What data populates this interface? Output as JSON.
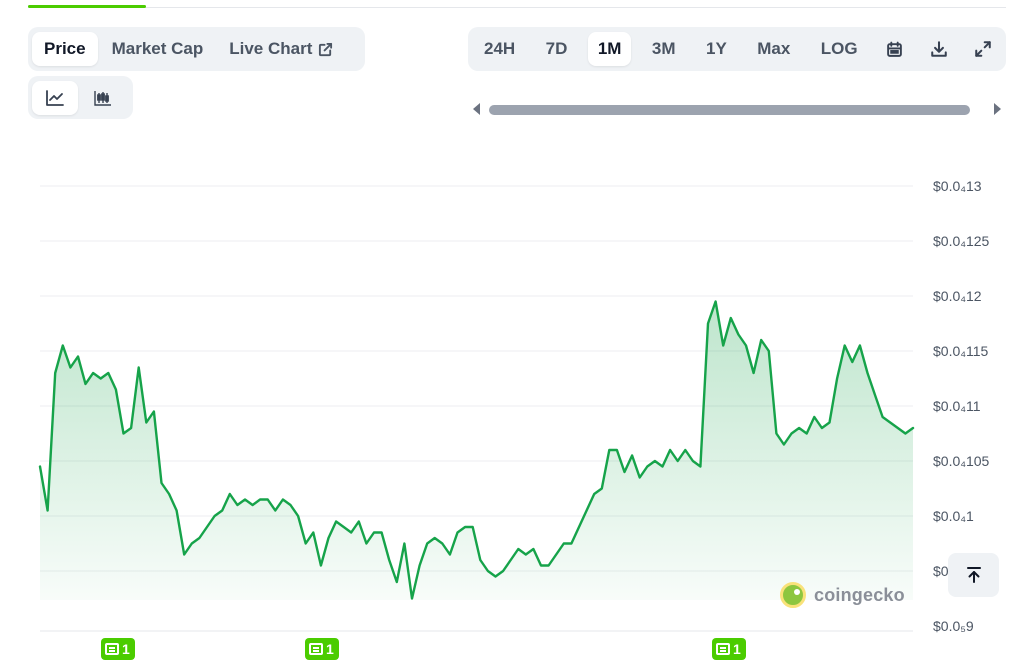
{
  "metric_tabs": [
    {
      "label": "Price",
      "active": true
    },
    {
      "label": "Market Cap",
      "active": false
    },
    {
      "label": "Live Chart",
      "active": false
    }
  ],
  "chart_type_toggle": [
    {
      "icon": "line-chart-icon",
      "active": true
    },
    {
      "icon": "candlestick-chart-icon",
      "active": false
    }
  ],
  "range_tabs": [
    {
      "label": "24H",
      "active": false
    },
    {
      "label": "7D",
      "active": false
    },
    {
      "label": "1M",
      "active": true
    },
    {
      "label": "3M",
      "active": false
    },
    {
      "label": "1Y",
      "active": false
    },
    {
      "label": "Max",
      "active": false
    },
    {
      "label": "LOG",
      "active": false
    }
  ],
  "range_icons": [
    "calendar-icon",
    "download-icon",
    "expand-icon"
  ],
  "watermark": "coingecko",
  "news_markers": [
    {
      "count": "1"
    },
    {
      "count": "1"
    },
    {
      "count": "1"
    }
  ],
  "colors": {
    "accent": "#4bcc00",
    "line": "#16a34a",
    "tab_bg": "#eff2f5"
  },
  "chart_data": {
    "type": "area",
    "title": "",
    "xlabel": "",
    "ylabel": "",
    "ylim": [
      8.95e-05,
      1.31e-05
    ],
    "y_tick_labels": [
      "$0.0₄13",
      "$0.0₄125",
      "$0.0₄12",
      "$0.0₄115",
      "$0.0₄11",
      "$0.0₄105",
      "$0.0₄1",
      "$0.0",
      "$0.0₅9"
    ],
    "y_tick_values": [
      1.3e-05,
      1.25e-05,
      1.2e-05,
      1.15e-05,
      1.1e-05,
      1.05e-05,
      1e-05,
      9.5e-06,
      9e-06
    ],
    "grid": true,
    "legend": "none",
    "series": [
      {
        "values": [
          1.045e-05,
          1.005e-05,
          1.13e-05,
          1.155e-05,
          1.135e-05,
          1.145e-05,
          1.12e-05,
          1.13e-05,
          1.125e-05,
          1.13e-05,
          1.115e-05,
          1.075e-05,
          1.08e-05,
          1.135e-05,
          1.085e-05,
          1.095e-05,
          1.03e-05,
          1.02e-05,
          1.005e-05,
          9.65e-06,
          9.75e-06,
          9.8e-06,
          9.9e-06,
          1e-05,
          1.005e-05,
          1.02e-05,
          1.01e-05,
          1.015e-05,
          1.01e-05,
          1.015e-05,
          1.015e-05,
          1.005e-05,
          1.015e-05,
          1.01e-05,
          1e-05,
          9.75e-06,
          9.85e-06,
          9.55e-06,
          9.8e-06,
          9.95e-06,
          9.9e-06,
          9.85e-06,
          9.95e-06,
          9.75e-06,
          9.85e-06,
          9.85e-06,
          9.6e-06,
          9.4e-06,
          9.75e-06,
          9.25e-06,
          9.55e-06,
          9.75e-06,
          9.8e-06,
          9.75e-06,
          9.65e-06,
          9.85e-06,
          9.9e-06,
          9.9e-06,
          9.6e-06,
          9.5e-06,
          9.45e-06,
          9.5e-06,
          9.6e-06,
          9.7e-06,
          9.65e-06,
          9.7e-06,
          9.55e-06,
          9.55e-06,
          9.65e-06,
          9.75e-06,
          9.75e-06,
          9.9e-06,
          1.005e-05,
          1.02e-05,
          1.025e-05,
          1.06e-05,
          1.06e-05,
          1.04e-05,
          1.055e-05,
          1.035e-05,
          1.045e-05,
          1.05e-05,
          1.045e-05,
          1.06e-05,
          1.05e-05,
          1.06e-05,
          1.05e-05,
          1.045e-05,
          1.175e-05,
          1.195e-05,
          1.155e-05,
          1.18e-05,
          1.165e-05,
          1.155e-05,
          1.13e-05,
          1.16e-05,
          1.15e-05,
          1.075e-05,
          1.065e-05,
          1.075e-05,
          1.08e-05,
          1.075e-05,
          1.09e-05,
          1.08e-05,
          1.085e-05,
          1.125e-05,
          1.155e-05,
          1.14e-05,
          1.155e-05,
          1.13e-05,
          1.11e-05,
          1.09e-05,
          1.085e-05,
          1.08e-05,
          1.075e-05,
          1.08e-05
        ]
      }
    ]
  }
}
